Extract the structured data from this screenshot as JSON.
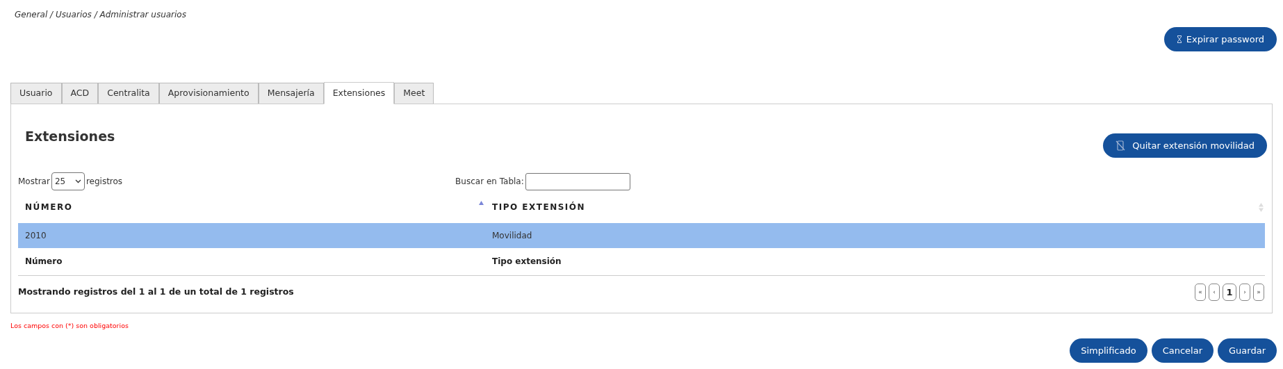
{
  "breadcrumb": "General / Usuarios / Administrar usuarios",
  "top_button": {
    "label": "Expirar password"
  },
  "tabs": [
    {
      "label": "Usuario",
      "selected": false
    },
    {
      "label": "ACD",
      "selected": false
    },
    {
      "label": "Centralita",
      "selected": false
    },
    {
      "label": "Aprovisionamiento",
      "selected": false
    },
    {
      "label": "Mensajería",
      "selected": false
    },
    {
      "label": "Extensiones",
      "selected": true
    },
    {
      "label": "Meet",
      "selected": false
    }
  ],
  "panel": {
    "title": "Extensiones",
    "action_button": {
      "label": "Quitar extensión movilidad"
    },
    "length": {
      "prefix": "Mostrar",
      "value": "25",
      "suffix": "registros"
    },
    "search": {
      "label": "Buscar en Tabla:"
    },
    "table": {
      "columns": [
        {
          "label": "NÚMERO",
          "sorted": true
        },
        {
          "label": "TIPO EXTENSIÓN",
          "sorted": false
        }
      ],
      "rows": [
        {
          "cells": [
            "2010",
            "Movilidad"
          ],
          "selected": true
        }
      ],
      "footer": [
        "Número",
        "Tipo extensión"
      ]
    },
    "info": "Mostrando registros del 1 al 1 de un total de 1 registros",
    "pagination": [
      {
        "label": "«",
        "selected": false
      },
      {
        "label": "‹",
        "selected": false
      },
      {
        "label": "1",
        "selected": true
      },
      {
        "label": "›",
        "selected": false
      },
      {
        "label": "»",
        "selected": false
      }
    ]
  },
  "required_note": "Los campos con (*) son obligatorios",
  "buttons": [
    "Simplificado",
    "Cancelar",
    "Guardar"
  ]
}
